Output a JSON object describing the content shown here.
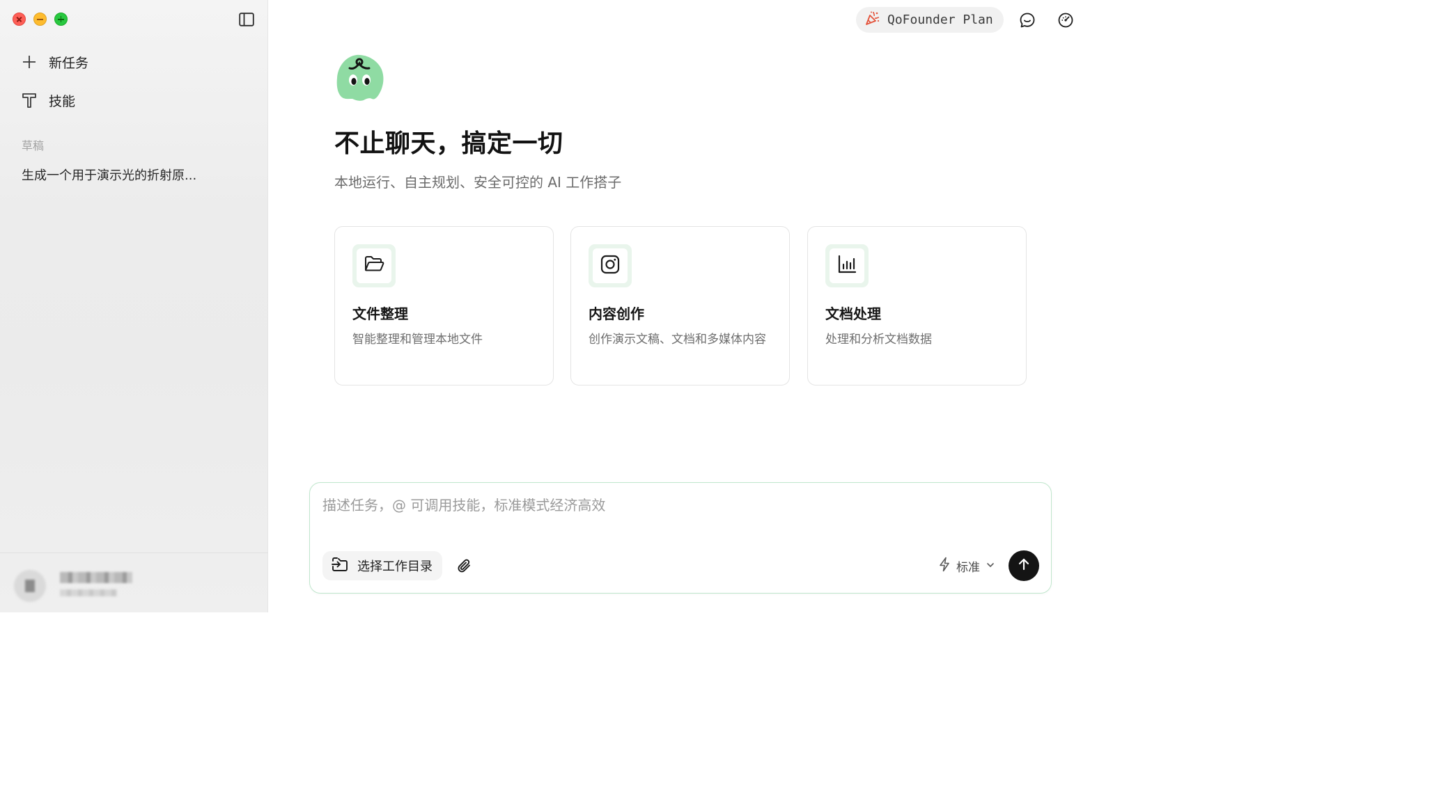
{
  "sidebar": {
    "new_task": "新任务",
    "skills": "技能",
    "section_label": "草稿",
    "drafts": [
      "生成一个用于演示光的折射原..."
    ]
  },
  "topbar": {
    "plan_label": "QoFounder Plan"
  },
  "hero": {
    "headline": "不止聊天，搞定一切",
    "subline": "本地运行、自主规划、安全可控的 AI 工作搭子"
  },
  "cards": [
    {
      "icon": "folder-open-icon",
      "title": "文件整理",
      "desc": "智能整理和管理本地文件"
    },
    {
      "icon": "instagram-icon",
      "title": "内容创作",
      "desc": "创作演示文稿、文档和多媒体内容"
    },
    {
      "icon": "bar-chart-icon",
      "title": "文档处理",
      "desc": "处理和分析文档数据"
    }
  ],
  "composer": {
    "placeholder": "描述任务，@ 可调用技能，标准模式经济高效",
    "select_dir": "选择工作目录",
    "mode": "标准"
  },
  "colors": {
    "accent_green": "#8fdba3",
    "card_badge_bg": "#e9f5ec",
    "composer_border": "#bfe6cc",
    "send_button": "#141414"
  }
}
